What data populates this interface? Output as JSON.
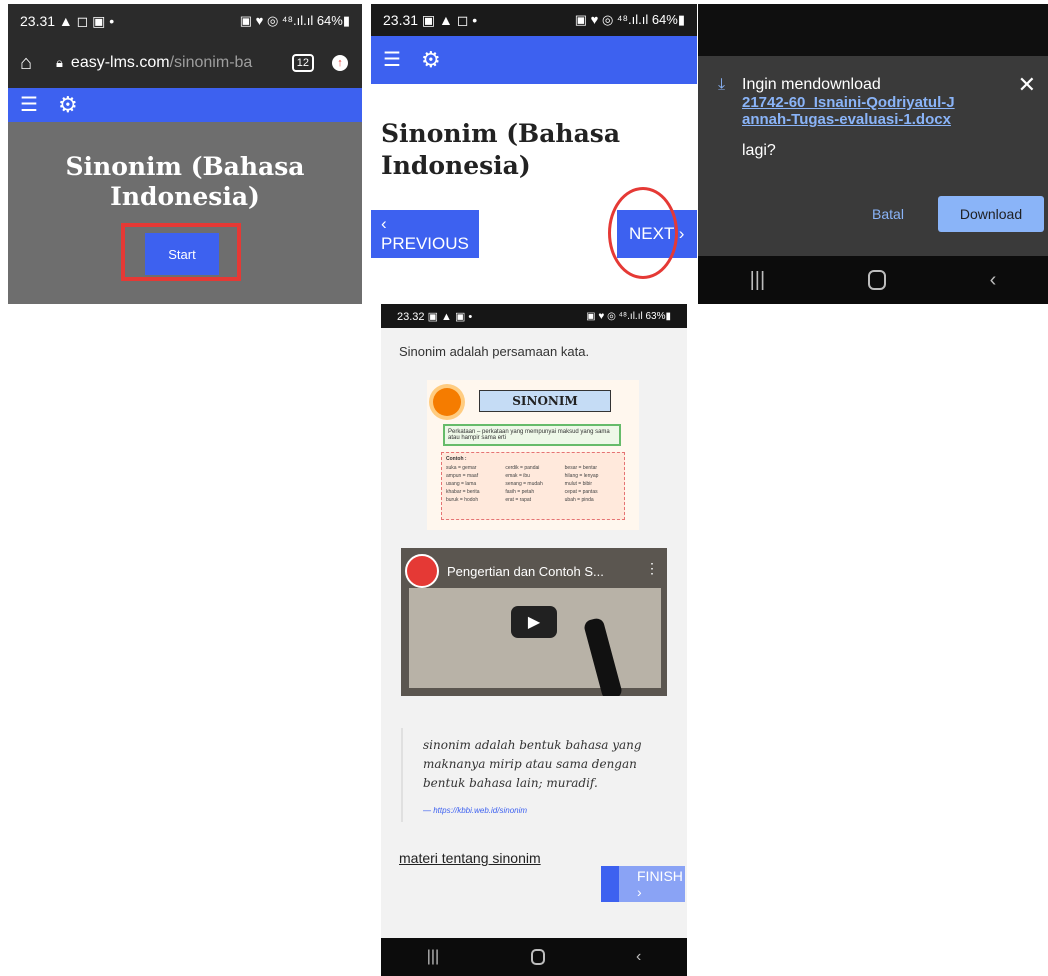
{
  "panel1": {
    "status_time": "23.31 ▲ ◻ ▣ •",
    "status_right": "▣ ♥ ◎ ⁴⁸.ıl.ıl 64%▮",
    "url_host": "easy-lms.com",
    "url_path": "/sinonim-ba",
    "tab_count": "12",
    "title": "Sinonim (Bahasa Indonesia)",
    "start_label": "Start"
  },
  "panel2": {
    "status_time": "23.31 ▣ ▲ ◻ •",
    "status_right": "▣ ♥ ◎ ⁴⁸.ıl.ıl 64%▮",
    "title": "Sinonim (Bahasa Indonesia)",
    "previous_label": "‹  PREVIOUS",
    "next_label": "NEXT  ›"
  },
  "panel3": {
    "heading": "Ingin mendownload",
    "filename": "21742-60_Isnaini-Qodriyatul-Jannah-Tugas-evaluasi-1.docx",
    "suffix": "lagi?",
    "cancel_label": "Batal",
    "download_label": "Download"
  },
  "panel4": {
    "status_time": "23.32 ▣ ▲ ▣ •",
    "status_right": "▣ ♥ ◎ ⁴⁸.ıl.ıl 63%▮",
    "intro_text": "Sinonim  adalah persamaan kata.",
    "image_title": "SINONIM",
    "image_definition": "Perkataan – perkataan yang mempunyai maksud yang sama atau hampir sama erti",
    "image_contoh": "Contoh :",
    "image_pairs": [
      "suka = gemar",
      "cerdik = pandai",
      "besar = bentar",
      "ampun = maaf",
      "emak = ibu",
      "hilang = lenyap",
      "usang = lama",
      "senang = mudah",
      "mulut = bibir",
      "khabar = berita",
      "fasih = petah",
      "cepat = pantas",
      "buruk = hodoh",
      "erat = rapat",
      "ubah = pinda"
    ],
    "video_title": "Pengertian dan Contoh S...",
    "quote_text": "sinonim adalah bentuk bahasa yang maknanya mirip atau sama dengan bentuk bahasa lain; muradif.",
    "quote_source": "— https://kbbi.web.id/sinonim",
    "link_text": "materi tentang sinonim",
    "finish_label": "FINISH  ›"
  },
  "colors": {
    "accent_blue": "#3d61f0",
    "highlight_red": "#e53935",
    "dialog_bg": "#3a3a3a",
    "download_btn": "#8ab4f8"
  }
}
